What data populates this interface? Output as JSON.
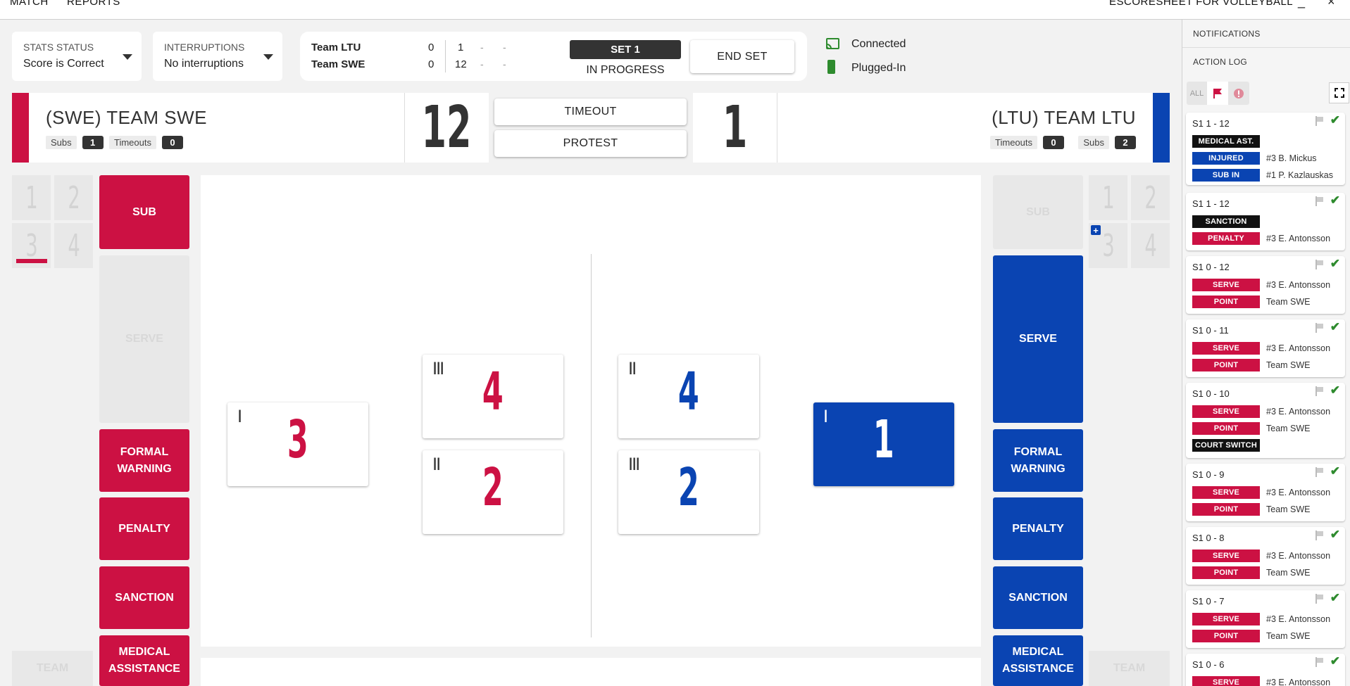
{
  "menu": {
    "match": "MATCH",
    "reports": "REPORTS",
    "app_title": "ESCORESHEET FOR VOLLEYBALL",
    "minimize": "_",
    "close": "×"
  },
  "stats_status": {
    "label": "STATS STATUS",
    "value": "Score is Correct"
  },
  "interruptions": {
    "label": "INTERRUPTIONS",
    "value": "No interruptions"
  },
  "set_scores": {
    "team1": {
      "name": "Team LTU",
      "sets": "0",
      "s1": "1",
      "s2": "-",
      "s3": "-"
    },
    "team2": {
      "name": "Team SWE",
      "sets": "0",
      "s1": "12",
      "s2": "-",
      "s3": "-"
    }
  },
  "set_badge": "SET 1",
  "set_status": "IN PROGRESS",
  "end_set": "END SET",
  "connection": {
    "status": "Connected",
    "power": "Plugged-In"
  },
  "home": {
    "name": "(SWE) TEAM SWE",
    "subs_label": "Subs",
    "subs": "1",
    "timeouts_label": "Timeouts",
    "timeouts": "0",
    "score": "12",
    "color": "#cc1143"
  },
  "away": {
    "name": "(LTU) TEAM LTU",
    "subs_label": "Subs",
    "subs": "2",
    "timeouts_label": "Timeouts",
    "timeouts": "0",
    "score": "1",
    "color": "#0a44b2"
  },
  "center_buttons": {
    "timeout": "TIMEOUT",
    "protest": "PROTEST"
  },
  "left_slots": [
    "1",
    "2",
    "3",
    "4"
  ],
  "right_slots": [
    "1",
    "2",
    "3",
    "4"
  ],
  "actions_left": {
    "sub": "SUB",
    "serve": "SERVE",
    "formal_warning": "FORMAL WARNING",
    "penalty": "PENALTY",
    "sanction": "SANCTION",
    "medical": "MEDICAL ASSISTANCE",
    "team": "TEAM"
  },
  "actions_right": {
    "sub": "SUB",
    "serve": "SERVE",
    "formal_warning": "FORMAL WARNING",
    "penalty": "PENALTY",
    "sanction": "SANCTION",
    "medical": "MEDICAL ASSISTANCE",
    "team": "TEAM"
  },
  "court": {
    "home_players": [
      {
        "tick": "I",
        "number": "3"
      },
      {
        "tick": "III",
        "number": "4"
      },
      {
        "tick": "II",
        "number": "2"
      }
    ],
    "away_players": [
      {
        "tick": "II",
        "number": "4"
      },
      {
        "tick": "III",
        "number": "2"
      },
      {
        "tick": "I",
        "number": "1"
      }
    ]
  },
  "sidebar": {
    "notifications": "NOTIFICATIONS",
    "action_log": "ACTION LOG",
    "filter_all": "ALL",
    "entries": [
      {
        "score": "S1  1 - 12",
        "rows": [
          {
            "tag": "MEDICAL AST.",
            "style": "black",
            "text": ""
          },
          {
            "tag": "INJURED",
            "style": "blue",
            "text": "#3 B. Mickus"
          },
          {
            "tag": "SUB IN",
            "style": "blue",
            "text": "#1 P. Kazlauskas"
          }
        ]
      },
      {
        "score": "S1  1 - 12",
        "rows": [
          {
            "tag": "SANCTION",
            "style": "black",
            "text": ""
          },
          {
            "tag": "PENALTY",
            "style": "red",
            "text": "#3 E. Antonsson"
          }
        ]
      },
      {
        "score": "S1  0 - 12",
        "rows": [
          {
            "tag": "SERVE",
            "style": "red",
            "text": "#3 E. Antonsson"
          },
          {
            "tag": "POINT",
            "style": "red",
            "text": "Team SWE"
          }
        ]
      },
      {
        "score": "S1  0 - 11",
        "rows": [
          {
            "tag": "SERVE",
            "style": "red",
            "text": "#3 E. Antonsson"
          },
          {
            "tag": "POINT",
            "style": "red",
            "text": "Team SWE"
          }
        ]
      },
      {
        "score": "S1  0 - 10",
        "rows": [
          {
            "tag": "SERVE",
            "style": "red",
            "text": "#3 E. Antonsson"
          },
          {
            "tag": "POINT",
            "style": "red",
            "text": "Team SWE"
          },
          {
            "tag": "COURT SWITCH",
            "style": "black",
            "text": ""
          }
        ]
      },
      {
        "score": "S1  0 - 9",
        "rows": [
          {
            "tag": "SERVE",
            "style": "red",
            "text": "#3 E. Antonsson"
          },
          {
            "tag": "POINT",
            "style": "red",
            "text": "Team SWE"
          }
        ]
      },
      {
        "score": "S1  0 - 8",
        "rows": [
          {
            "tag": "SERVE",
            "style": "red",
            "text": "#3 E. Antonsson"
          },
          {
            "tag": "POINT",
            "style": "red",
            "text": "Team SWE"
          }
        ]
      },
      {
        "score": "S1  0 - 7",
        "rows": [
          {
            "tag": "SERVE",
            "style": "red",
            "text": "#3 E. Antonsson"
          },
          {
            "tag": "POINT",
            "style": "red",
            "text": "Team SWE"
          }
        ]
      },
      {
        "score": "S1  0 - 6",
        "rows": [
          {
            "tag": "SERVE",
            "style": "red",
            "text": "#3 E. Antonsson"
          }
        ]
      }
    ]
  }
}
